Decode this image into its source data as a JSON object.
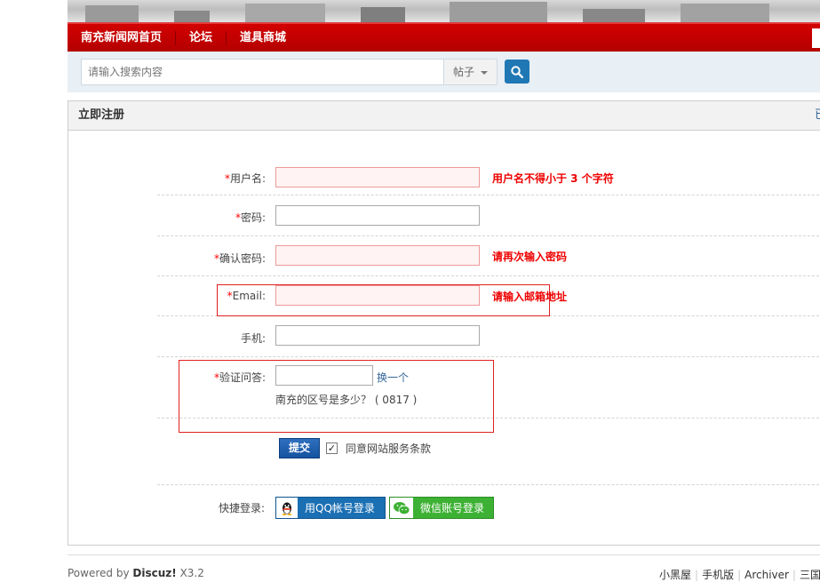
{
  "nav": {
    "items": [
      "南充新闻网首页",
      "论坛",
      "道具商城"
    ]
  },
  "search": {
    "placeholder": "请输入搜索内容",
    "type_label": "帖子"
  },
  "panel": {
    "title": "立即注册",
    "tail": "已"
  },
  "form": {
    "required_mark": "*",
    "username_label": "用户名:",
    "username_msg": "用户名不得小于 3 个字符",
    "password_label": "密码:",
    "confirm_label": "确认密码:",
    "confirm_msg": "请再次输入密码",
    "email_label": "Email:",
    "email_msg": "请输入邮箱地址",
    "phone_label": "手机:",
    "captcha_label": "验证问答:",
    "captcha_change": "换一个",
    "captcha_question": "南充的区号是多少？ ( 0817 )",
    "submit_label": "提交",
    "agree_label": "同意网站服务条款",
    "quick_login_label": "快捷登录:",
    "qq_login": "用QQ帐号登录",
    "wechat_login": "微信账号登录"
  },
  "footer": {
    "powered_prefix": "Powered by",
    "powered_brand": "Discuz!",
    "version": "X3.2",
    "links": [
      "小黑屋",
      "手机版",
      "Archiver",
      "三国"
    ]
  },
  "colors": {
    "nav_red": "#c40000",
    "error_red": "#e00000",
    "submit_blue": "#1f5fa8",
    "qq_blue": "#1b6fb3",
    "wechat_green": "#3db134"
  }
}
